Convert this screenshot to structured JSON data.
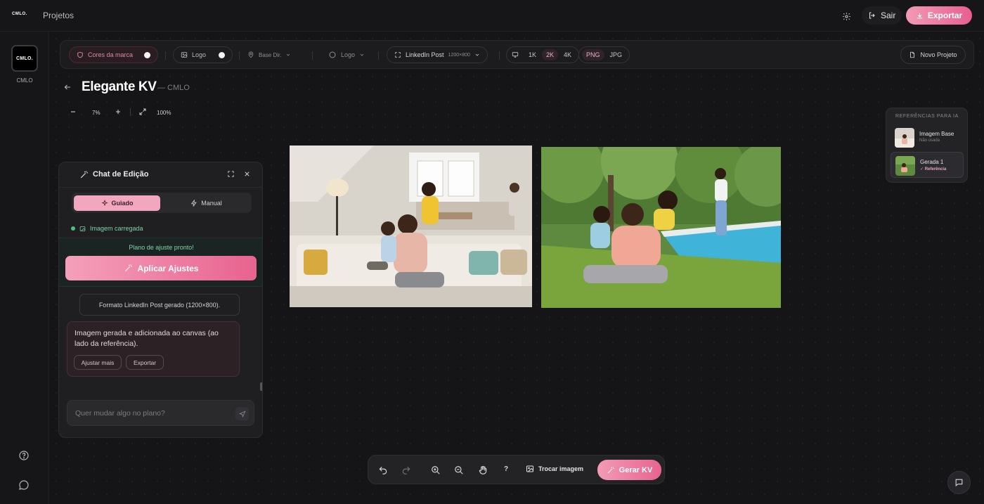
{
  "topbar": {
    "brand_mini": "CMLO.",
    "nav_projects": "Projetos",
    "sair_label": "Sair",
    "export_label": "Exportar"
  },
  "rail": {
    "logo_text": "CMLO.",
    "brand_name": "CMLO"
  },
  "toolbar": {
    "brand_colors_label": "Cores da marca",
    "logo_label": "Logo",
    "base_dir_label": "Base Dir.",
    "logo_select_label": "Logo",
    "format_label": "LinkedIn Post",
    "format_size": "1200×800",
    "resolutions": [
      "1K",
      "2K",
      "4K"
    ],
    "resolution_selected": "2K",
    "file_formats": [
      "PNG",
      "JPG"
    ],
    "file_format_selected": "PNG",
    "new_project_label": "Novo Projeto"
  },
  "project": {
    "title": "Elegante KV",
    "subtitle": "— CMLO"
  },
  "zoom": {
    "level": "7%",
    "full": "100%"
  },
  "references": {
    "title": "REFERÊNCIAS PARA IA",
    "items": [
      {
        "name": "Imagem Base",
        "status": "Não usada"
      },
      {
        "name": "Gerada 1",
        "status": "✓ Referência"
      }
    ]
  },
  "chat": {
    "title": "Chat de Edição",
    "modes": [
      "Guiado",
      "Manual"
    ],
    "mode_selected": "Guiado",
    "image_status": "Imagem carregada",
    "plan_ready": "Plano de ajuste pronto!",
    "apply_label": "Aplicar Ajustes",
    "system_message": "Formato LinkedIn Post gerado (1200×800).",
    "bot_message": "Imagem gerada e adicionada ao canvas (ao lado da referência).",
    "bot_actions": [
      "Ajustar mais",
      "Exportar"
    ],
    "input_placeholder": "Quer mudar algo no plano?"
  },
  "bottombar": {
    "help_label": "?",
    "swap_label": "Trocar imagem",
    "generate_label": "Gerar KV"
  },
  "colors": {
    "accent": "#e8638f",
    "accent_light": "#f4a0bb",
    "success": "#4fbf83",
    "background": "#141416"
  }
}
